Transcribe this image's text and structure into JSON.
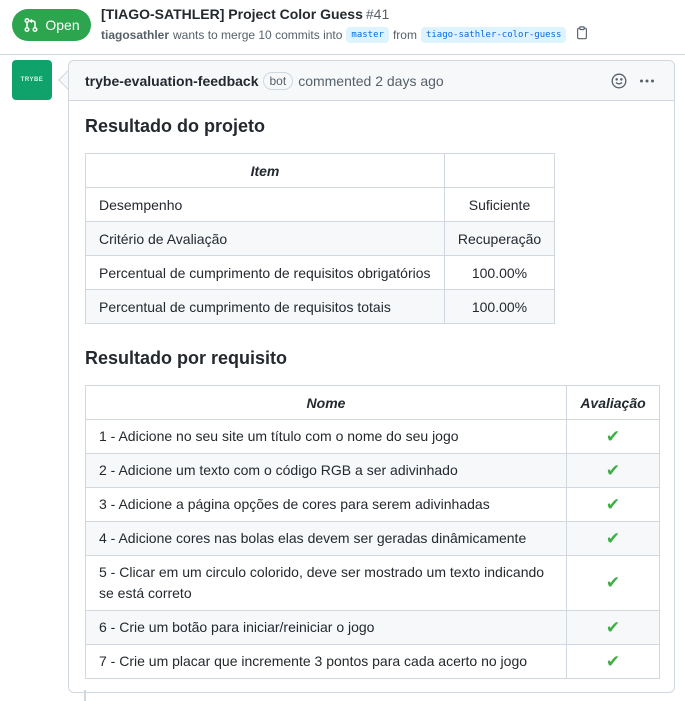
{
  "pr": {
    "state": "Open",
    "title": "[TIAGO-SATHLER] Project Color Guess",
    "number": "#41",
    "author": "tiagosathler",
    "merge_text": "wants to merge 10 commits into",
    "base_branch": "master",
    "from_text": "from",
    "head_branch": "tiago-sathler-color-guess"
  },
  "avatar": {
    "text": "TRYBE"
  },
  "comment": {
    "author": "trybe-evaluation-feedback",
    "badge": "bot",
    "timestamp": "commented 2 days ago"
  },
  "project_result": {
    "heading": "Resultado do projeto",
    "columns": [
      "Item",
      ""
    ],
    "rows": [
      {
        "item": "Desempenho",
        "value": "Suficiente"
      },
      {
        "item": "Critério de Avaliação",
        "value": "Recuperação"
      },
      {
        "item": "Percentual de cumprimento de requisitos obrigatórios",
        "value": "100.00%"
      },
      {
        "item": "Percentual de cumprimento de requisitos totais",
        "value": "100.00%"
      }
    ]
  },
  "requirements": {
    "heading": "Resultado por requisito",
    "columns": [
      "Nome",
      "Avaliação"
    ],
    "rows": [
      {
        "name": "1 - Adicione no seu site um título com o nome do seu jogo",
        "status": "✔"
      },
      {
        "name": "2 - Adicione um texto com o código RGB a ser adivinhado",
        "status": "✔"
      },
      {
        "name": "3 - Adicione a página opções de cores para serem adivinhadas",
        "status": "✔"
      },
      {
        "name": "4 - Adicione cores nas bolas elas devem ser geradas dinâmicamente",
        "status": "✔"
      },
      {
        "name": "5 - Clicar em um circulo colorido, deve ser mostrado um texto indicando se está correto",
        "status": "✔"
      },
      {
        "name": "6 - Crie um botão para iniciar/reiniciar o jogo",
        "status": "✔"
      },
      {
        "name": "7 - Crie um placar que incremente 3 pontos para cada acerto no jogo",
        "status": "✔"
      }
    ]
  },
  "colors": {
    "open_green": "#2da44e",
    "check_green": "#3cb043",
    "branch_bg": "#ddf4ff",
    "branch_fg": "#0969da",
    "avatar_bg": "#0fa36b"
  }
}
